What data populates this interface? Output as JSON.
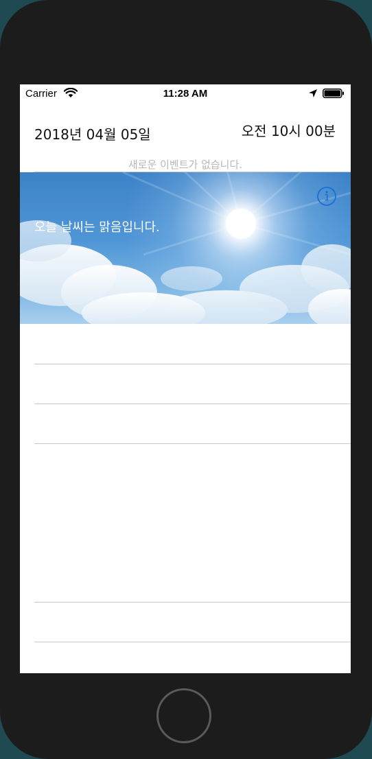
{
  "status_bar": {
    "carrier": "Carrier",
    "time": "11:28 AM"
  },
  "header": {
    "date": "2018년 04월 05일",
    "time": "오전 10시 00분"
  },
  "events": {
    "empty_message": "새로운 이벤트가 없습니다."
  },
  "weather": {
    "message": "오늘 날씨는 맑음입니다."
  },
  "colors": {
    "accent": "#1a6fd6",
    "sky_top": "#3c82c8",
    "divider": "#c8c8c8",
    "placeholder_text": "#b8b8b8"
  },
  "icons": {
    "info": "info-circle-icon",
    "wifi": "wifi-icon",
    "location": "location-arrow-icon",
    "battery": "battery-icon"
  }
}
